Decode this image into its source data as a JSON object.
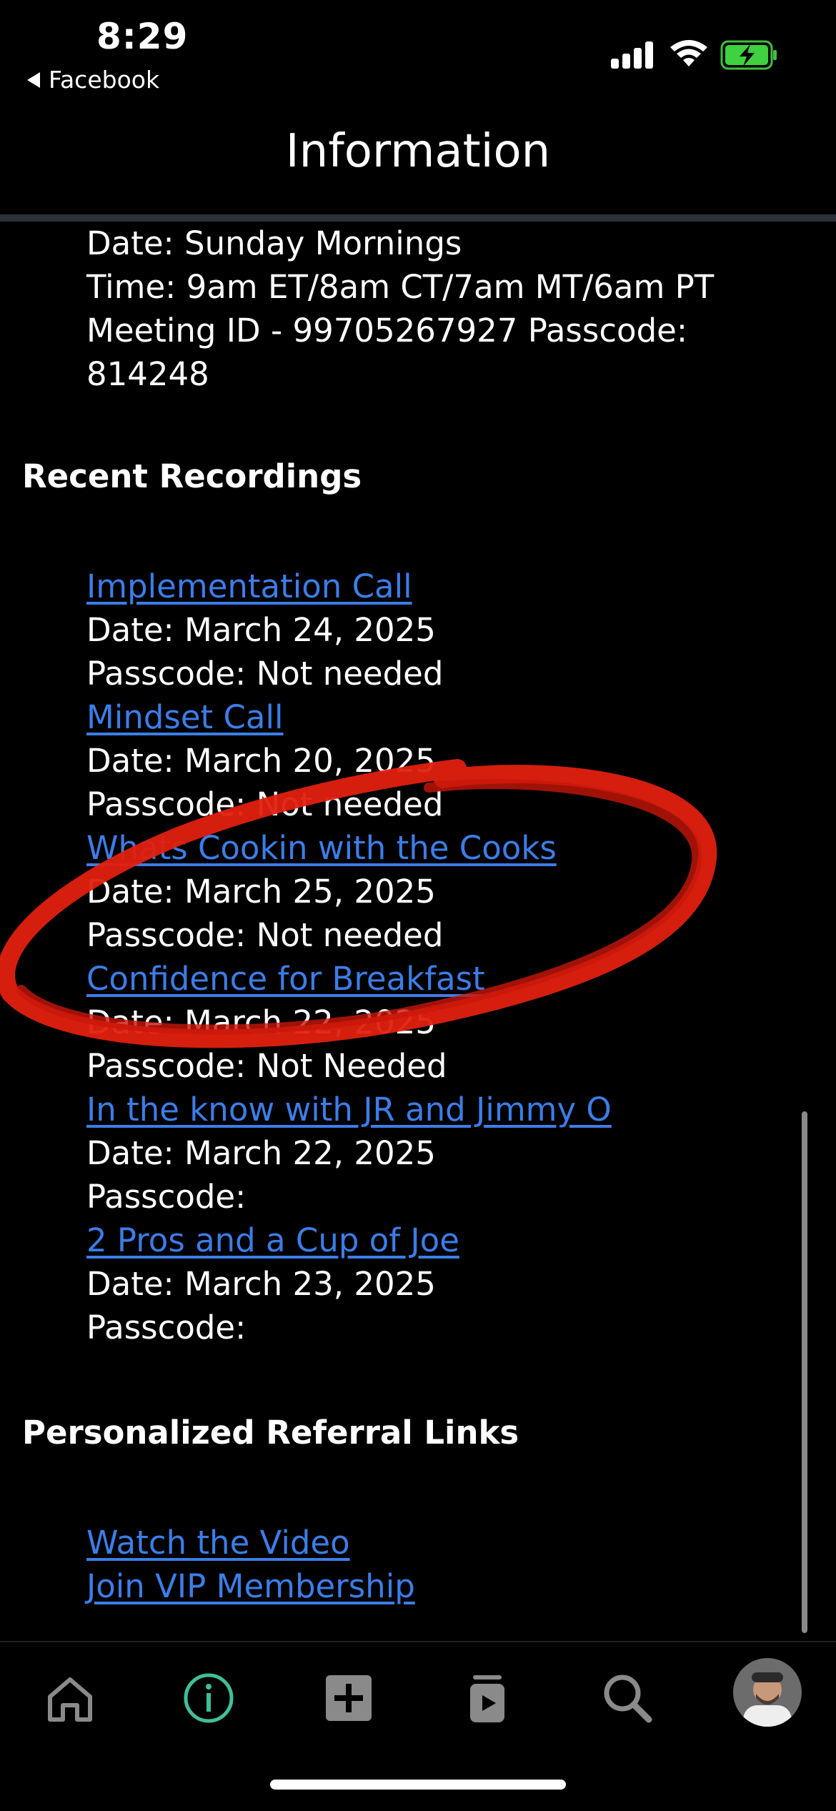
{
  "status_bar": {
    "time": "8:29",
    "back_app": "Facebook"
  },
  "header": {
    "title": "Information"
  },
  "meeting": {
    "date": "Date: Sunday Mornings",
    "time": "Time: 9am ET/8am CT/7am MT/6am PT",
    "id_line": "Meeting ID - 99705267927 Passcode:",
    "passcode": "814248"
  },
  "recent_recordings": {
    "heading": "Recent Recordings",
    "items": [
      {
        "title": "Implementation Call",
        "date": "Date: March 24, 2025",
        "passcode": "Passcode: Not needed"
      },
      {
        "title": "Mindset Call",
        "date": "Date: March 20, 2025",
        "passcode": "Passcode: Not needed"
      },
      {
        "title": "Whats Cookin with the Cooks",
        "date": "Date: March 25, 2025",
        "passcode": "Passcode: Not needed"
      },
      {
        "title": "Confidence for Breakfast",
        "date": "Date: March 22, 2025",
        "passcode": "Passcode: Not Needed"
      },
      {
        "title": "In the know with JR and Jimmy O",
        "date": "Date: March 22, 2025",
        "passcode": "Passcode:"
      },
      {
        "title": "2 Pros and a Cup of Joe",
        "date": "Date: March 23, 2025",
        "passcode": "Passcode:"
      }
    ]
  },
  "referral_links": {
    "heading": "Personalized Referral Links",
    "items": [
      "Watch the Video",
      "Join VIP Membership"
    ]
  },
  "tab_bar": {
    "tabs": [
      "home-icon",
      "info-icon",
      "add-icon",
      "library-icon",
      "search-icon",
      "avatar"
    ],
    "active_tab": "info-icon",
    "active_color": "#3fbf9a"
  },
  "colors": {
    "link": "#3c7de8",
    "annotation": "#e0200f"
  }
}
